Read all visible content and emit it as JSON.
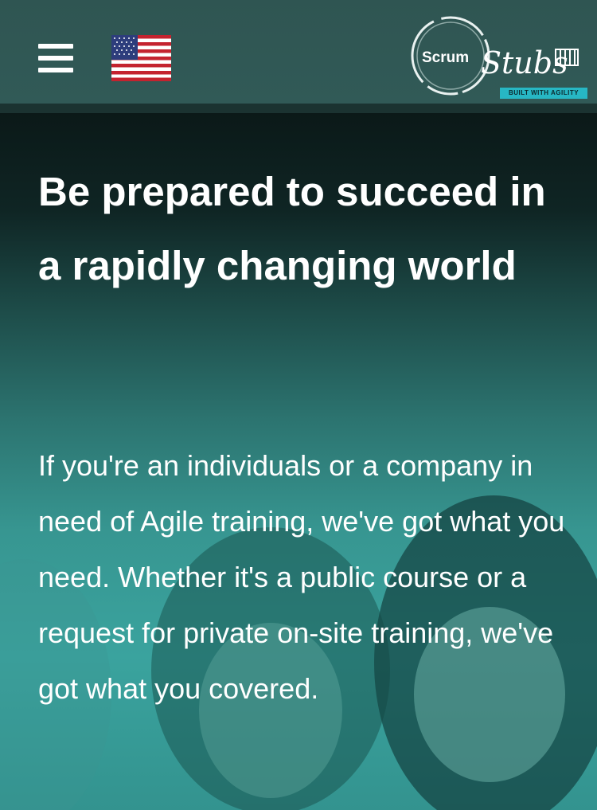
{
  "header": {
    "menu_label": "Menu",
    "language_flag": "us-flag-icon",
    "logo": {
      "name": "Scrum",
      "script": "Stubs",
      "tagline": "BUILT WITH AGILITY"
    }
  },
  "hero": {
    "title": "Be prepared to succeed in a rapidly changing world",
    "body": "If you're an individuals or a company in need of Agile training, we've got what you need. Whether it's a public course or a request for private on-site training, we've got what you covered."
  },
  "colors": {
    "header_bg": "#2f5552",
    "accent_teal": "#27b7c4",
    "text": "#ffffff"
  }
}
